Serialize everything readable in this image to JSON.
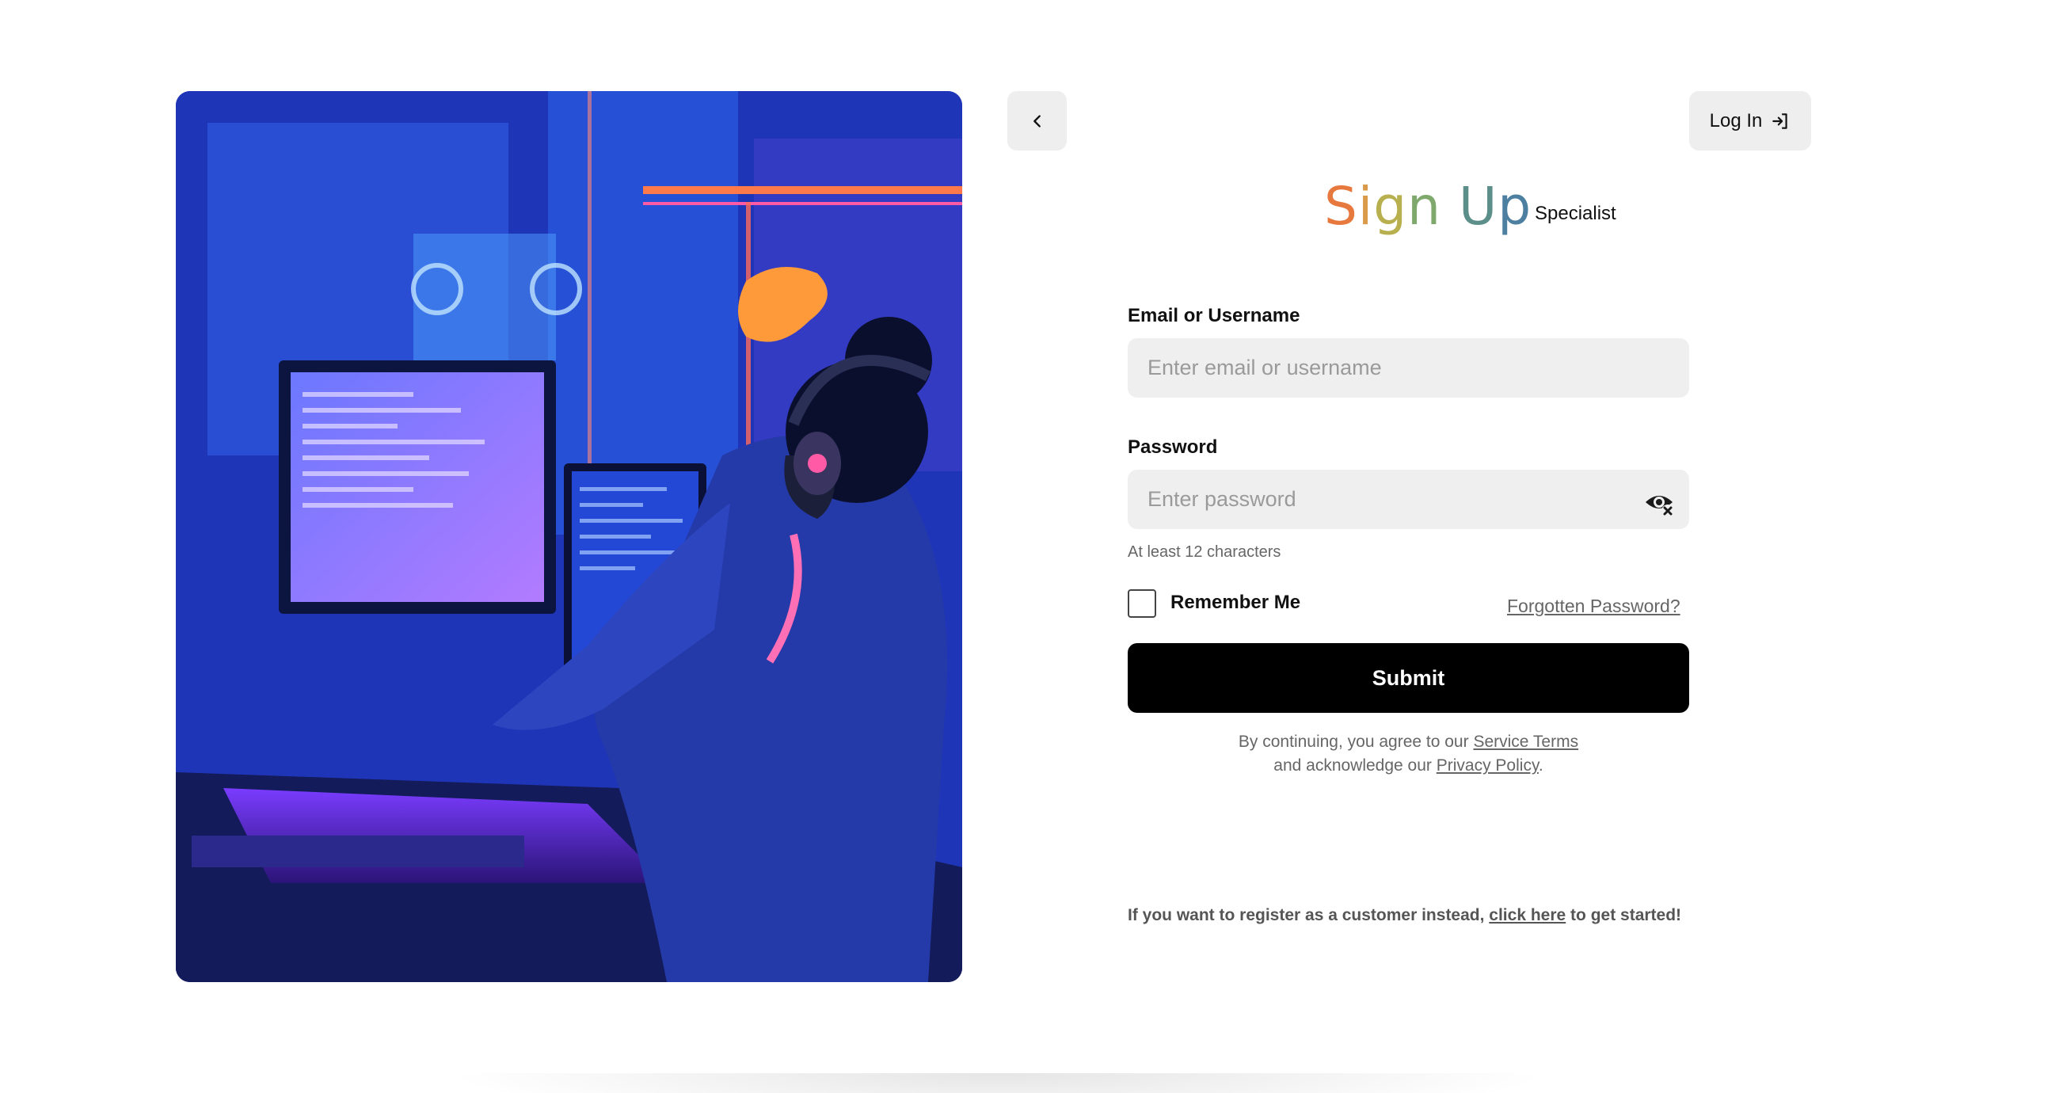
{
  "nav": {
    "back_icon": "chevron-left-icon",
    "login_label": "Log In",
    "login_icon": "log-in-icon"
  },
  "header": {
    "title_parts": [
      "S",
      "i",
      "g",
      "n",
      " U",
      "p"
    ],
    "role": "Specialist"
  },
  "form": {
    "email_label": "Email or Username",
    "email_placeholder": "Enter email or username",
    "password_label": "Password",
    "password_placeholder": "Enter password",
    "password_hint": "At least 12 characters",
    "remember_label": "Remember Me",
    "forgot_label": "Forgotten Password?",
    "submit_label": "Submit"
  },
  "terms": {
    "line1_prefix": "By continuing, you agree to our ",
    "service_terms": "Service Terms",
    "line2_prefix": "and acknowledge our ",
    "privacy_policy": "Privacy Policy",
    "line2_suffix": "."
  },
  "customer": {
    "prefix": "If you want to register as a customer instead, ",
    "link": "click here",
    "suffix": " to get started!"
  },
  "colors": {
    "title_gradient": [
      "#e8793e",
      "#d99a4a",
      "#b8b04f",
      "#7fa86c",
      "#5c8f8a",
      "#4d7fa0"
    ],
    "submit_bg": "#000000",
    "field_bg": "#efefef"
  }
}
